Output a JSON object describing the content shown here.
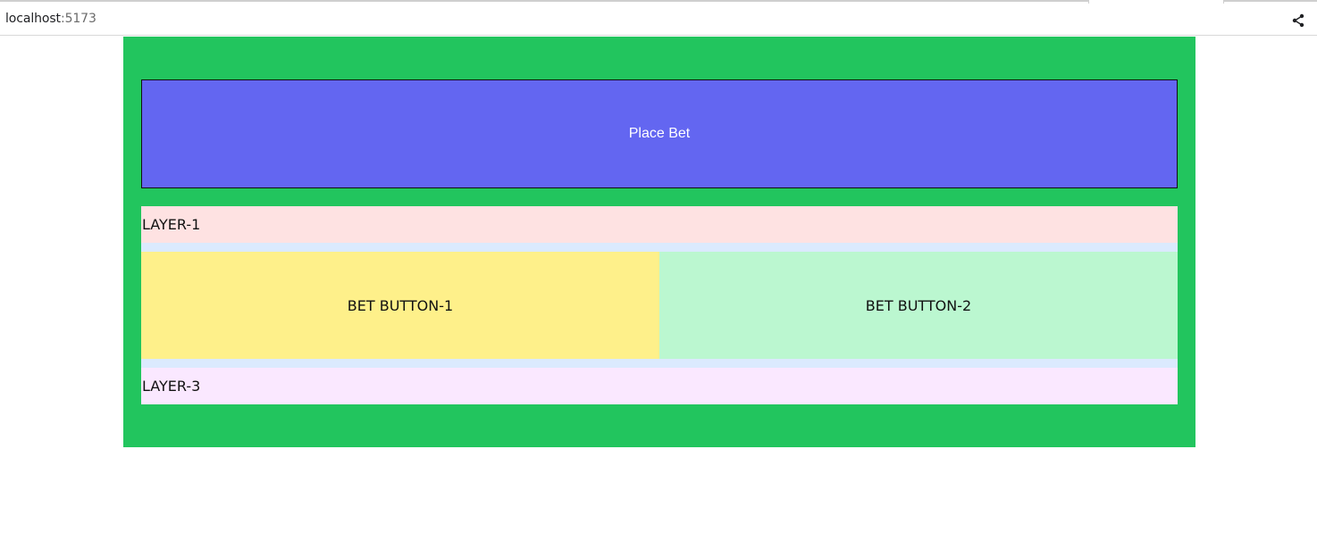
{
  "browser": {
    "url_host": "localhost",
    "url_port": ":5173",
    "share_icon": "share-icon"
  },
  "app": {
    "place_bet_label": "Place Bet",
    "layer_1_label": "LAYER-1",
    "bet_button_1_label": "BET BUTTON-1",
    "bet_button_2_label": "BET BUTTON-2",
    "layer_3_label": "LAYER-3"
  },
  "colors": {
    "panel": "#22c55e",
    "place_bet": "#6366f1",
    "layer_1": "#fee2e2",
    "bet_button_1": "#fef08a",
    "bet_button_2": "#bbf7d0",
    "layer_3": "#fae8ff",
    "stack_gap": "#dbeafe"
  }
}
